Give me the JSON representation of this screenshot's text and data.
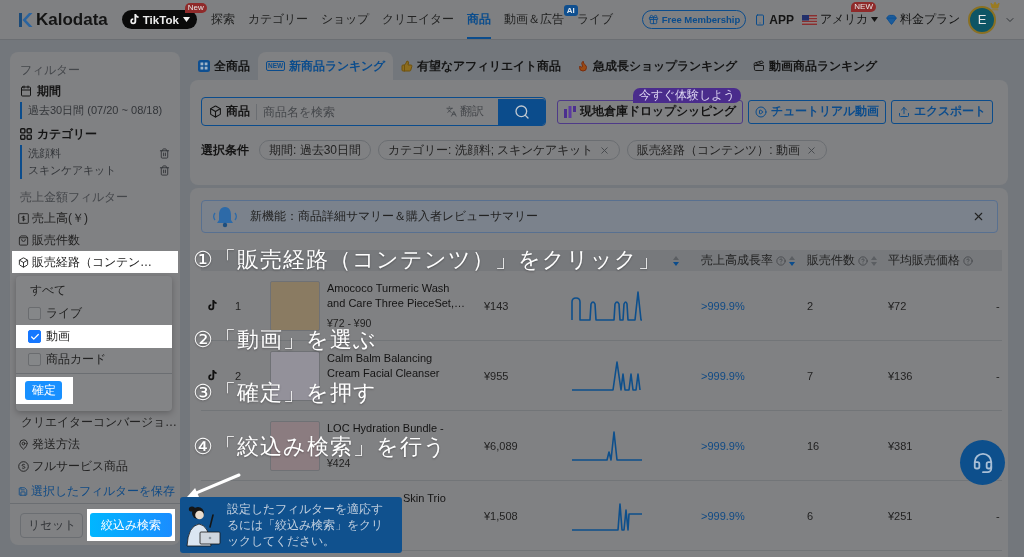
{
  "nav": {
    "logo": "Kalodata",
    "platform": {
      "label": "TikTok",
      "badge": "New"
    },
    "items": [
      {
        "label": "探索",
        "selected": false
      },
      {
        "label": "カテゴリー",
        "selected": false
      },
      {
        "label": "ショップ",
        "selected": false
      },
      {
        "label": "クリエイター",
        "selected": false
      },
      {
        "label": "商品",
        "selected": true
      },
      {
        "label": "動画＆広告",
        "selected": false,
        "badge": "AI"
      },
      {
        "label": "ライブ",
        "selected": false
      }
    ],
    "membership": "Free Membership",
    "app": "APP",
    "region": {
      "label": "アメリカ",
      "badge": "NEW"
    },
    "pricing": "料金プラン",
    "avatar": "E"
  },
  "sidebar": {
    "title": "フィルター",
    "period": {
      "label": "期間",
      "value": "過去30日間 (07/20 ~ 08/18)"
    },
    "category": {
      "label": "カテゴリー",
      "values": [
        "洗顔料",
        "スキンケアキット"
      ]
    },
    "sales_title": "売上金額フィルター",
    "filters": [
      {
        "label": "売上高(￥)",
        "highlighted": false
      },
      {
        "label": "販売件数",
        "highlighted": false
      },
      {
        "label": "販売経路（コンテン…",
        "highlighted": true
      }
    ],
    "channel_menu": {
      "options": [
        {
          "kind": "all",
          "label": "すべて"
        },
        {
          "kind": "checkbox",
          "label": "ライブ",
          "checked": false,
          "highlighted": false
        },
        {
          "kind": "checkbox",
          "label": "動画",
          "checked": true,
          "highlighted": true
        },
        {
          "kind": "checkbox",
          "label": "商品カード",
          "checked": false,
          "highlighted": false
        }
      ],
      "confirm": {
        "label": "確定",
        "highlighted": true
      }
    },
    "more_filters": [
      "クリエイターコンバージョ…",
      "発送方法",
      "フルサービス商品"
    ],
    "save": "選択したフィルターを保存",
    "reset": "リセット",
    "apply": {
      "label": "絞込み検索",
      "highlighted": true
    }
  },
  "tabs": [
    {
      "label": "全商品",
      "selected": false
    },
    {
      "label": "新商品ランキング",
      "selected": true,
      "tag": "NEW"
    },
    {
      "label": "有望なアフィリエイト商品",
      "selected": false
    },
    {
      "label": "急成長ショップランキング",
      "selected": false
    },
    {
      "label": "動画商品ランキング",
      "selected": false
    }
  ],
  "search": {
    "label": "商品",
    "placeholder": "商品名を検索",
    "translate": "翻訳"
  },
  "actions": [
    {
      "kind": "promo",
      "label": "現地倉庫ドロップシッピング",
      "badge": "今すぐ体験しよう"
    },
    {
      "kind": "outline",
      "label": "チュートリアル動画"
    },
    {
      "kind": "outline",
      "label": "エクスポート"
    }
  ],
  "conditions": {
    "label": "選択条件",
    "chips": [
      {
        "label": "期間: 過去30日間",
        "removable": false
      },
      {
        "label": "カテゴリー: 洗顔料; スキンケアキット",
        "removable": true
      },
      {
        "label": "販売経路（コンテンツ）: 動画",
        "removable": true
      }
    ]
  },
  "banner": {
    "text": "新機能：商品詳細サマリー＆購入者レビューサマリー"
  },
  "table": {
    "columns": [
      {
        "sorted": true
      },
      {
        "label": "売上高成長率",
        "help": true,
        "sorted": true
      },
      {
        "label": "販売件数",
        "help": true,
        "sorted": false
      },
      {
        "label": "平均販売価格",
        "help": true
      }
    ],
    "rows": [
      {
        "rank": "1",
        "photo": true,
        "name": "Amococo Turmeric Wash\nand Care Three PieceSet,…",
        "price_range": "¥72 - ¥90",
        "sales": "¥143",
        "growth": ">999.9%",
        "units": "2",
        "avg_price": "¥72",
        "column_9": "-"
      },
      {
        "rank": "2",
        "photo": true,
        "name": "Calm Balm Balancing\nCream Facial Cleanser",
        "sales": "¥955",
        "growth": ">999.9%",
        "units": "7",
        "avg_price": "¥136",
        "column_9": "-"
      },
      {
        "photo": true,
        "name": "LOC Hydration Bundle -",
        "price_range": "¥424",
        "sales": "¥6,089",
        "growth": ">999.9%",
        "units": "16",
        "avg_price": "¥381"
      },
      {
        "name": "Skin Trio",
        "sales": "¥1,508",
        "growth": ">999.9%",
        "units": "6",
        "avg_price": "¥251",
        "column_9": "-"
      }
    ]
  },
  "guide": {
    "steps": [
      "①「販売経路（コンテンツ）」をクリック」",
      "②「動画」を選ぶ",
      "③「確定」を押す",
      "④「絞込み検索」を行う"
    ],
    "tip": "設定したフィルターを適応するには「絞込み検索」をクリックしてください。"
  }
}
